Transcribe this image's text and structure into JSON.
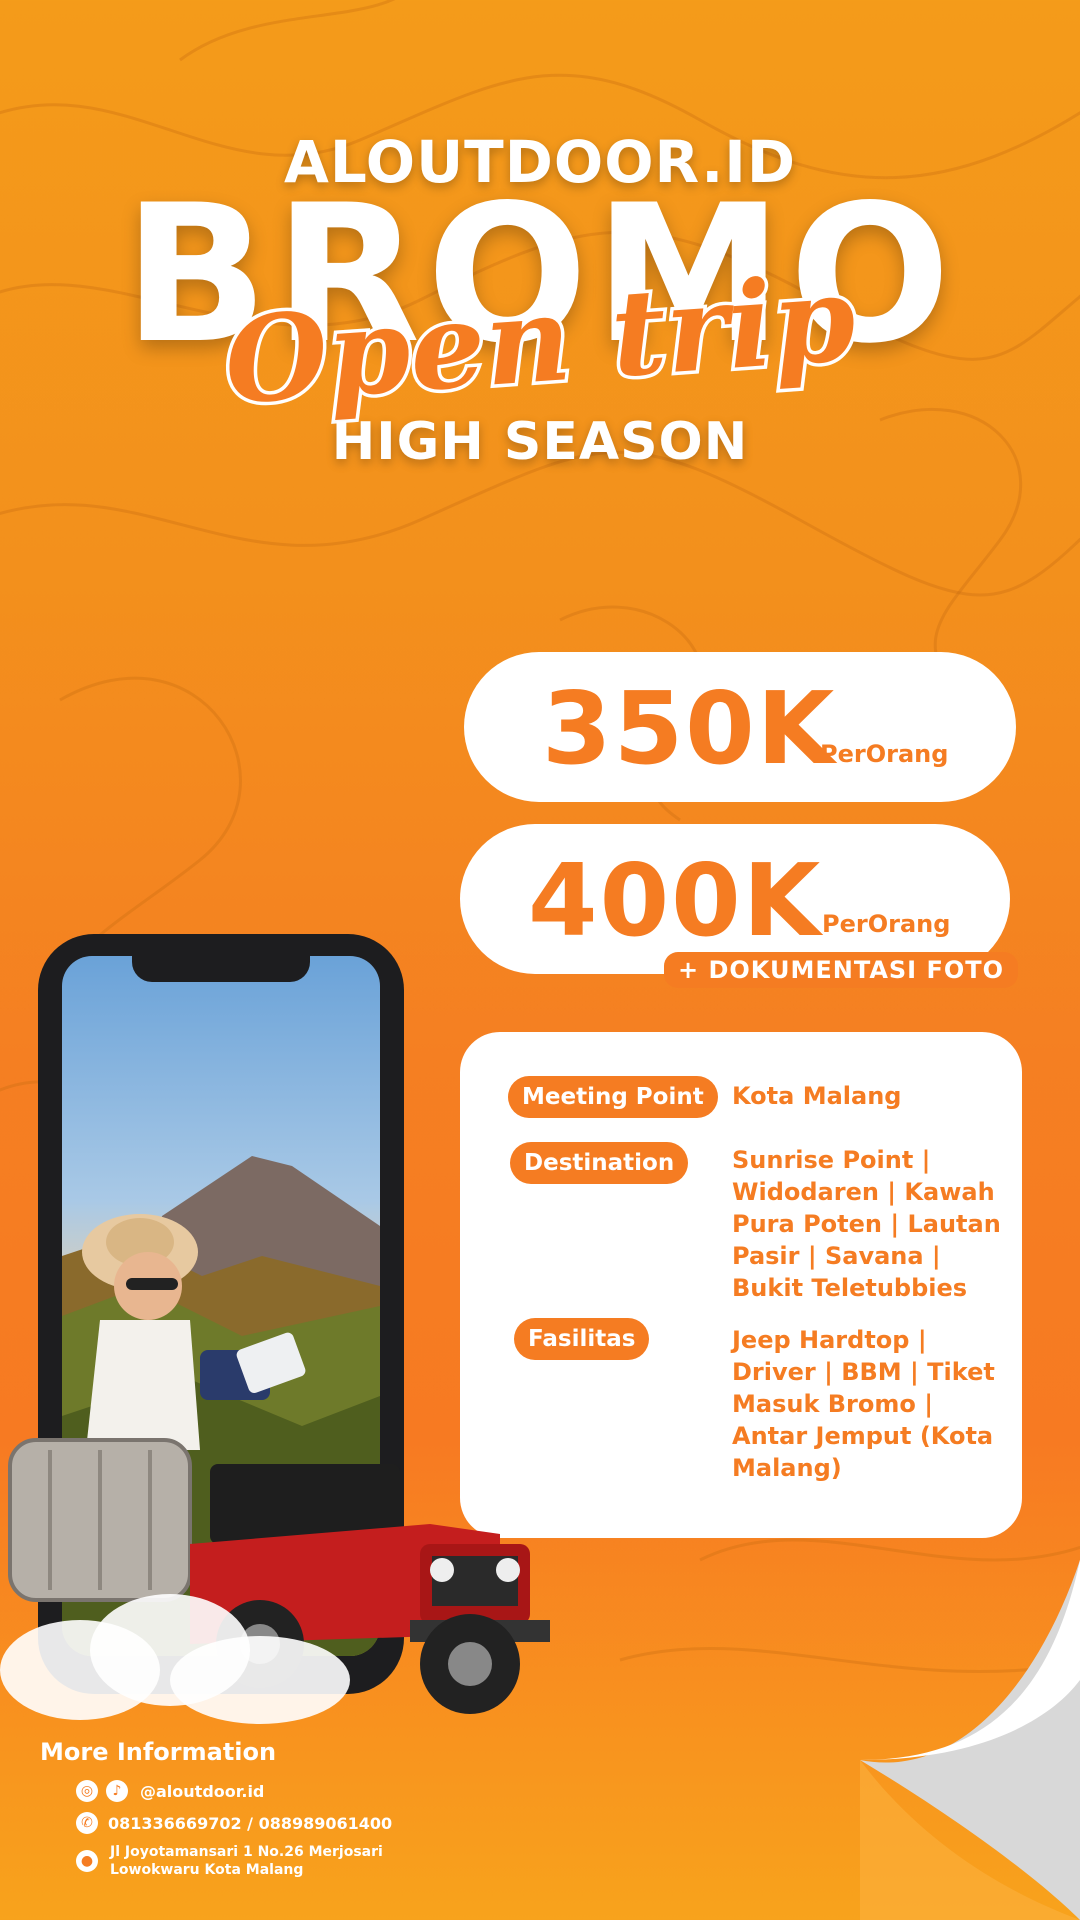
{
  "header": {
    "brand": "ALOUTDOOR.ID",
    "title": "BROMO",
    "script_title": "Open trip",
    "subtitle": "HIGH SEASON"
  },
  "prices": [
    {
      "amount": "350K",
      "unit": "PerOrang"
    },
    {
      "amount": "400K",
      "unit": "PerOrang",
      "extra": "+ DOKUMENTASI  FOTO"
    }
  ],
  "details": {
    "meeting_label": "Meeting Point",
    "meeting_value": "Kota Malang",
    "destination_label": "Destination",
    "destination_value": "Sunrise Point | Widodaren | Kawah Pura Poten | Lautan Pasir | Savana | Bukit Teletubbies",
    "facilities_label": "Fasilitas",
    "facilities_value": "Jeep Hardtop | Driver | BBM | Tiket Masuk Bromo | Antar Jemput (Kota Malang)"
  },
  "footer": {
    "heading": "More Information",
    "social": "@aloutdoor.id",
    "phone": "081336669702 / 088989061400",
    "address_line1": "Jl Joyotamansari 1 No.26 Merjosari",
    "address_line2": "Lowokwaru Kota Malang"
  },
  "colors": {
    "accent": "#f57c22",
    "background": "#f49b1a",
    "white": "#ffffff"
  },
  "icons": [
    "instagram-icon",
    "tiktok-icon",
    "whatsapp-icon",
    "location-pin-icon"
  ]
}
